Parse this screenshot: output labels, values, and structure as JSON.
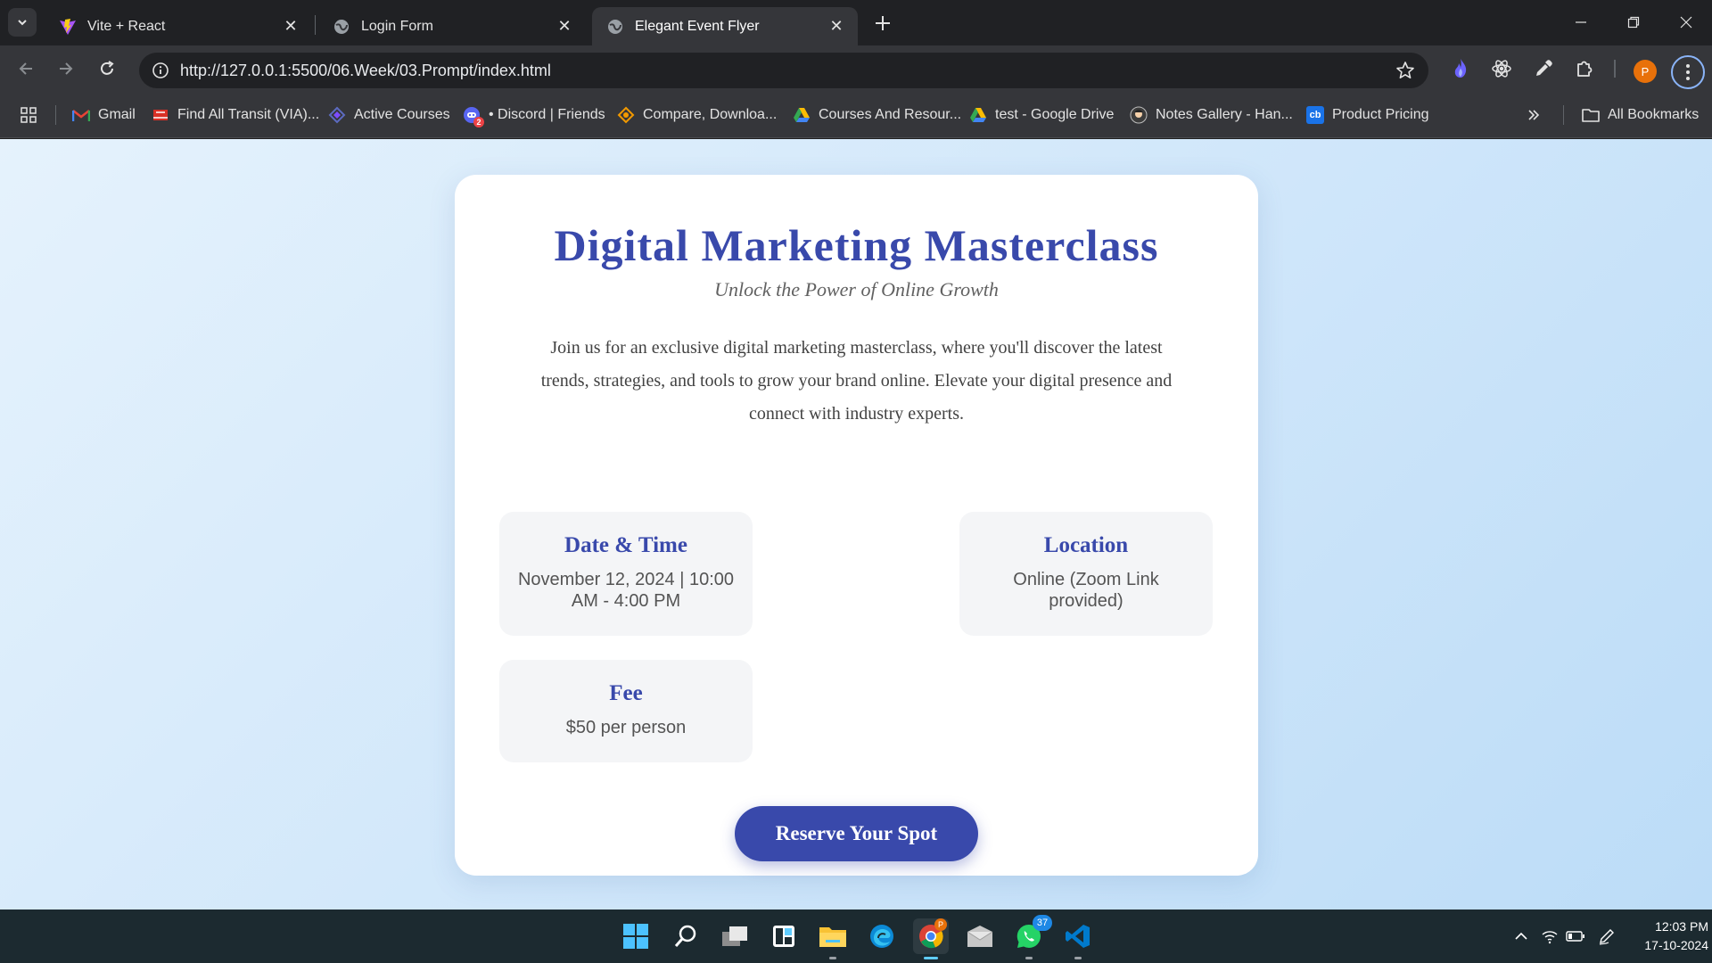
{
  "browser": {
    "tabs": [
      {
        "title": "Vite + React",
        "icon": "vite-icon"
      },
      {
        "title": "Login Form",
        "icon": "globe-icon"
      },
      {
        "title": "Elegant Event Flyer",
        "icon": "globe-icon",
        "active": true
      }
    ],
    "url": "http://127.0.0.1:5500/06.Week/03.Prompt/index.html",
    "profile_initial": "P",
    "bookmarks": [
      {
        "label": "Gmail",
        "icon": "gmail-icon"
      },
      {
        "label": "Find All Transit (VIA)...",
        "icon": "transit-icon"
      },
      {
        "label": "Active Courses",
        "icon": "courses-icon"
      },
      {
        "label": "• Discord | Friends",
        "icon": "discord-icon",
        "badge": "2"
      },
      {
        "label": "Compare, Downloa...",
        "icon": "compare-icon"
      },
      {
        "label": "Courses And Resour...",
        "icon": "google-drive-icon"
      },
      {
        "label": "test - Google Drive",
        "icon": "google-drive-icon"
      },
      {
        "label": "Notes Gallery - Han...",
        "icon": "notes-icon"
      },
      {
        "label": "Product Pricing",
        "icon": "cb-icon",
        "icon_text": "cb"
      }
    ],
    "all_bookmarks_label": "All Bookmarks"
  },
  "page": {
    "title": "Digital Marketing Masterclass",
    "subtitle": "Unlock the Power of Online Growth",
    "description": "Join us for an exclusive digital marketing masterclass, where you'll discover the latest trends, strategies, and tools to grow your brand online. Elevate your digital presence and connect with industry experts.",
    "date_time": {
      "heading": "Date & Time",
      "value": "November 12, 2024 | 10:00 AM - 4:00 PM"
    },
    "location": {
      "heading": "Location",
      "value": "Online (Zoom Link provided)"
    },
    "fee": {
      "heading": "Fee",
      "value": "$50 per person"
    },
    "cta_label": "Reserve Your Spot",
    "accent_color": "#3949ab"
  },
  "taskbar": {
    "whatsapp_badge": "37",
    "chrome_badge": "P",
    "time": "12:03 PM",
    "date": "17-10-2024"
  }
}
